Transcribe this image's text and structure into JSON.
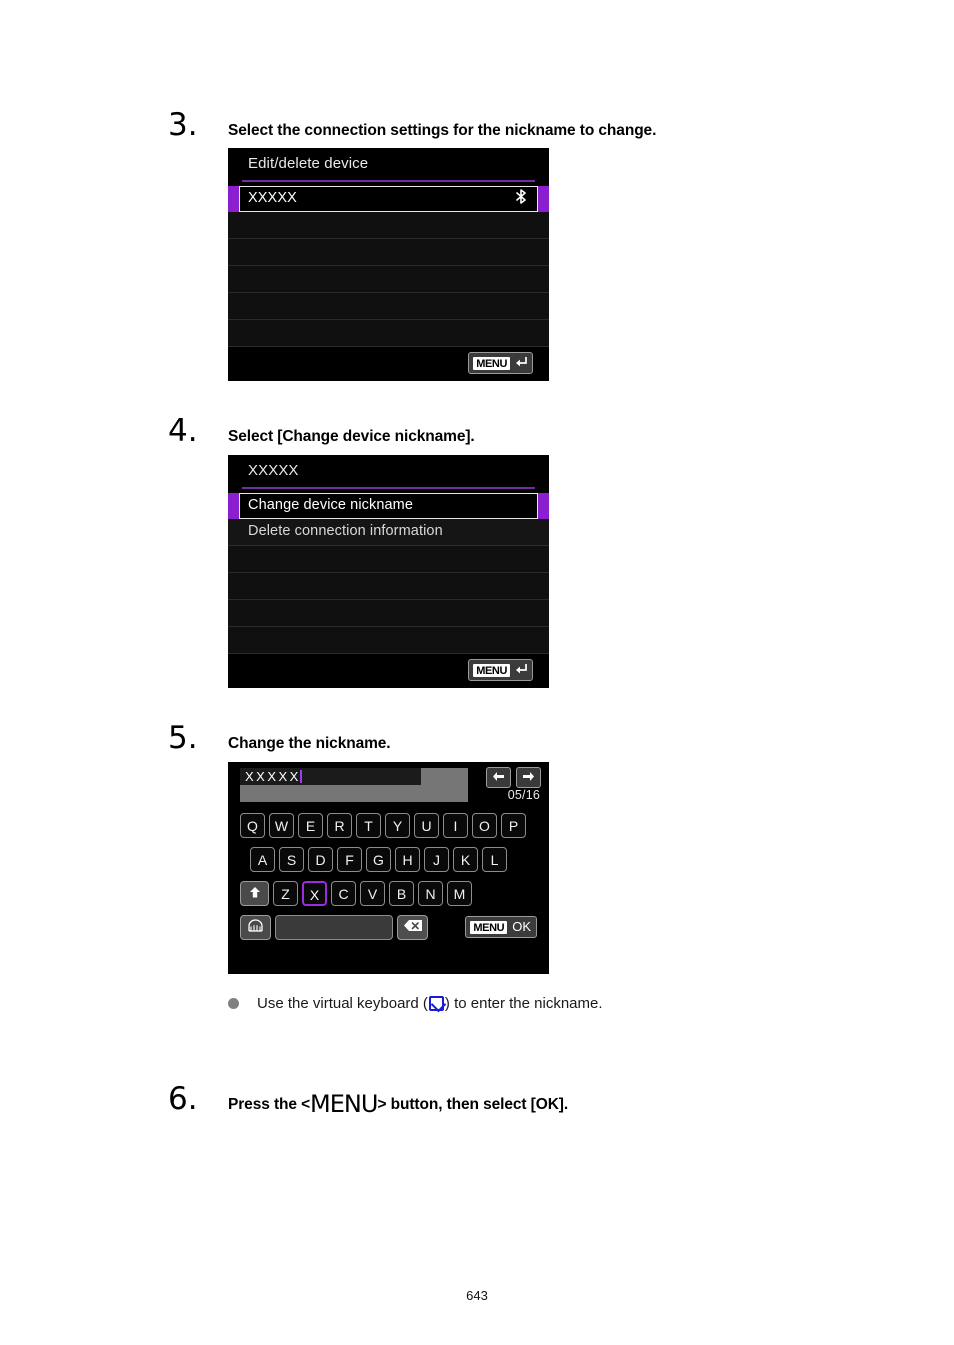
{
  "document": {
    "page_number": "643"
  },
  "steps": [
    {
      "number": "3.",
      "title": "Select the connection settings for the nickname to change.",
      "screen": {
        "type": "list",
        "header_title": "Edit/delete device",
        "rows": [
          {
            "label": "XXXXX",
            "selected": true,
            "right_icon": "bluetooth-icon",
            "right_glyph": "ᛗ"
          },
          {
            "label": "",
            "selected": false
          },
          {
            "label": "",
            "selected": false
          },
          {
            "label": "",
            "selected": false
          },
          {
            "label": "",
            "selected": false
          },
          {
            "label": "",
            "selected": false
          }
        ],
        "footer": {
          "menu_label": "MENU",
          "back_glyph": "↩"
        }
      }
    },
    {
      "number": "4.",
      "title": "Select [Change device nickname].",
      "screen": {
        "type": "list",
        "header_title": "XXXXX",
        "rows": [
          {
            "label": "Change device nickname",
            "selected": true
          },
          {
            "label": "Delete connection information",
            "selected": false
          },
          {
            "label": "",
            "selected": false
          },
          {
            "label": "",
            "selected": false
          },
          {
            "label": "",
            "selected": false
          },
          {
            "label": "",
            "selected": false
          }
        ],
        "footer": {
          "menu_label": "MENU",
          "back_glyph": "↩"
        }
      }
    },
    {
      "number": "5.",
      "title": "Change the nickname.",
      "screen": {
        "type": "keyboard",
        "input_value": "XXXXX",
        "char_count": "05/16",
        "cursor_left_glyph": "←",
        "cursor_right_glyph": "→",
        "rows": [
          [
            "Q",
            "W",
            "E",
            "R",
            "T",
            "Y",
            "U",
            "I",
            "O",
            "P"
          ],
          [
            "A",
            "S",
            "D",
            "F",
            "G",
            "H",
            "J",
            "K",
            "L"
          ],
          [
            "Z",
            "X",
            "C",
            "V",
            "B",
            "N",
            "M"
          ]
        ],
        "shift_key_glyph": "⬆",
        "input_mode_key_glyph": "⌨",
        "space_key_label": "",
        "backspace_key_glyph": "⌫",
        "selected_key": "X",
        "confirm": {
          "menu_label": "MENU",
          "ok_label": "OK"
        }
      },
      "note": {
        "text_before": "Use the virtual keyboard (",
        "icon": "virtual-keyboard-link-icon",
        "text_after": ") to enter the nickname."
      }
    },
    {
      "number": "6.",
      "title_before": "Press the <",
      "title_glyph": "MENU",
      "title_after": "> button, then select [OK]."
    }
  ]
}
